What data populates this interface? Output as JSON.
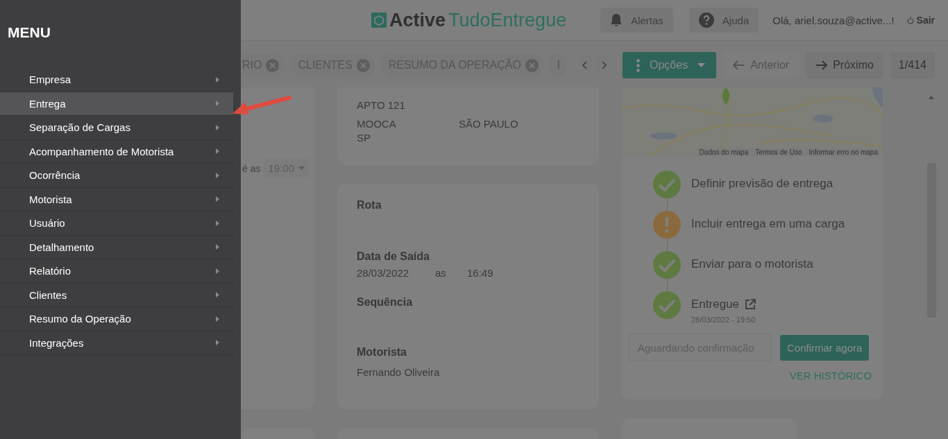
{
  "menu": {
    "title": "MENU",
    "items": [
      {
        "label": "Empresa",
        "selected": false
      },
      {
        "label": "Entrega",
        "selected": true
      },
      {
        "label": "Separação de Cargas",
        "selected": false
      },
      {
        "label": "Acompanhamento de Motorista",
        "selected": false
      },
      {
        "label": "Ocorrência",
        "selected": false
      },
      {
        "label": "Motorista",
        "selected": false
      },
      {
        "label": "Usuário",
        "selected": false
      },
      {
        "label": "Detalhamento",
        "selected": false
      },
      {
        "label": "Relatório",
        "selected": false
      },
      {
        "label": "Clientes",
        "selected": false
      },
      {
        "label": "Resumo da Operação",
        "selected": false
      },
      {
        "label": "Integrações",
        "selected": false
      }
    ]
  },
  "header": {
    "logo_bold": "Active",
    "logo_light": "TudoEntregue",
    "alerts": "Alertas",
    "help": "Ajuda",
    "greeting": "Olá, ariel.souza@active...!",
    "logout": "Sair"
  },
  "tabs": [
    {
      "label": "RIO",
      "closable": true
    },
    {
      "label": "CLIENTES",
      "closable": true
    },
    {
      "label": "RESUMO DA OPERAÇÃO",
      "closable": true
    },
    {
      "label": "I",
      "closable": false
    }
  ],
  "toolbar": {
    "options": "Opções",
    "previous": "Anterior",
    "previous_disabled": true,
    "next": "Próximo",
    "counter": "1/414"
  },
  "schedule": {
    "label": "é as",
    "time": "19:00"
  },
  "address": {
    "complement": "APTO 121",
    "district": "MOOCA",
    "city": "SÃO PAULO",
    "state": "SP"
  },
  "route": {
    "title": "Rota",
    "departure_label": "Data de Saída",
    "departure_date": "28/03/2022",
    "departure_as": "as",
    "departure_time": "16:49",
    "sequence_label": "Sequência",
    "driver_label": "Motorista",
    "driver": "Fernando Oliveira"
  },
  "map": {
    "kind": "picture",
    "links": [
      "Dados do mapa",
      "Termos de Uso",
      "Informar erro no mapa"
    ]
  },
  "steps": [
    {
      "kind": "done",
      "label": "Definir previsão de entrega",
      "link": false
    },
    {
      "kind": "warning",
      "label": "Incluir entrega em uma carga",
      "link": false
    },
    {
      "kind": "done",
      "label": "Enviar para o motorista",
      "link": false
    },
    {
      "kind": "done",
      "label": "Entregue",
      "link": true,
      "date": "28/03/2022 - 19:50"
    }
  ],
  "confirmation": {
    "placeholder": "Aguardando confirmação",
    "button": "Confirmar agora",
    "history": "VER HISTÓRICO"
  }
}
